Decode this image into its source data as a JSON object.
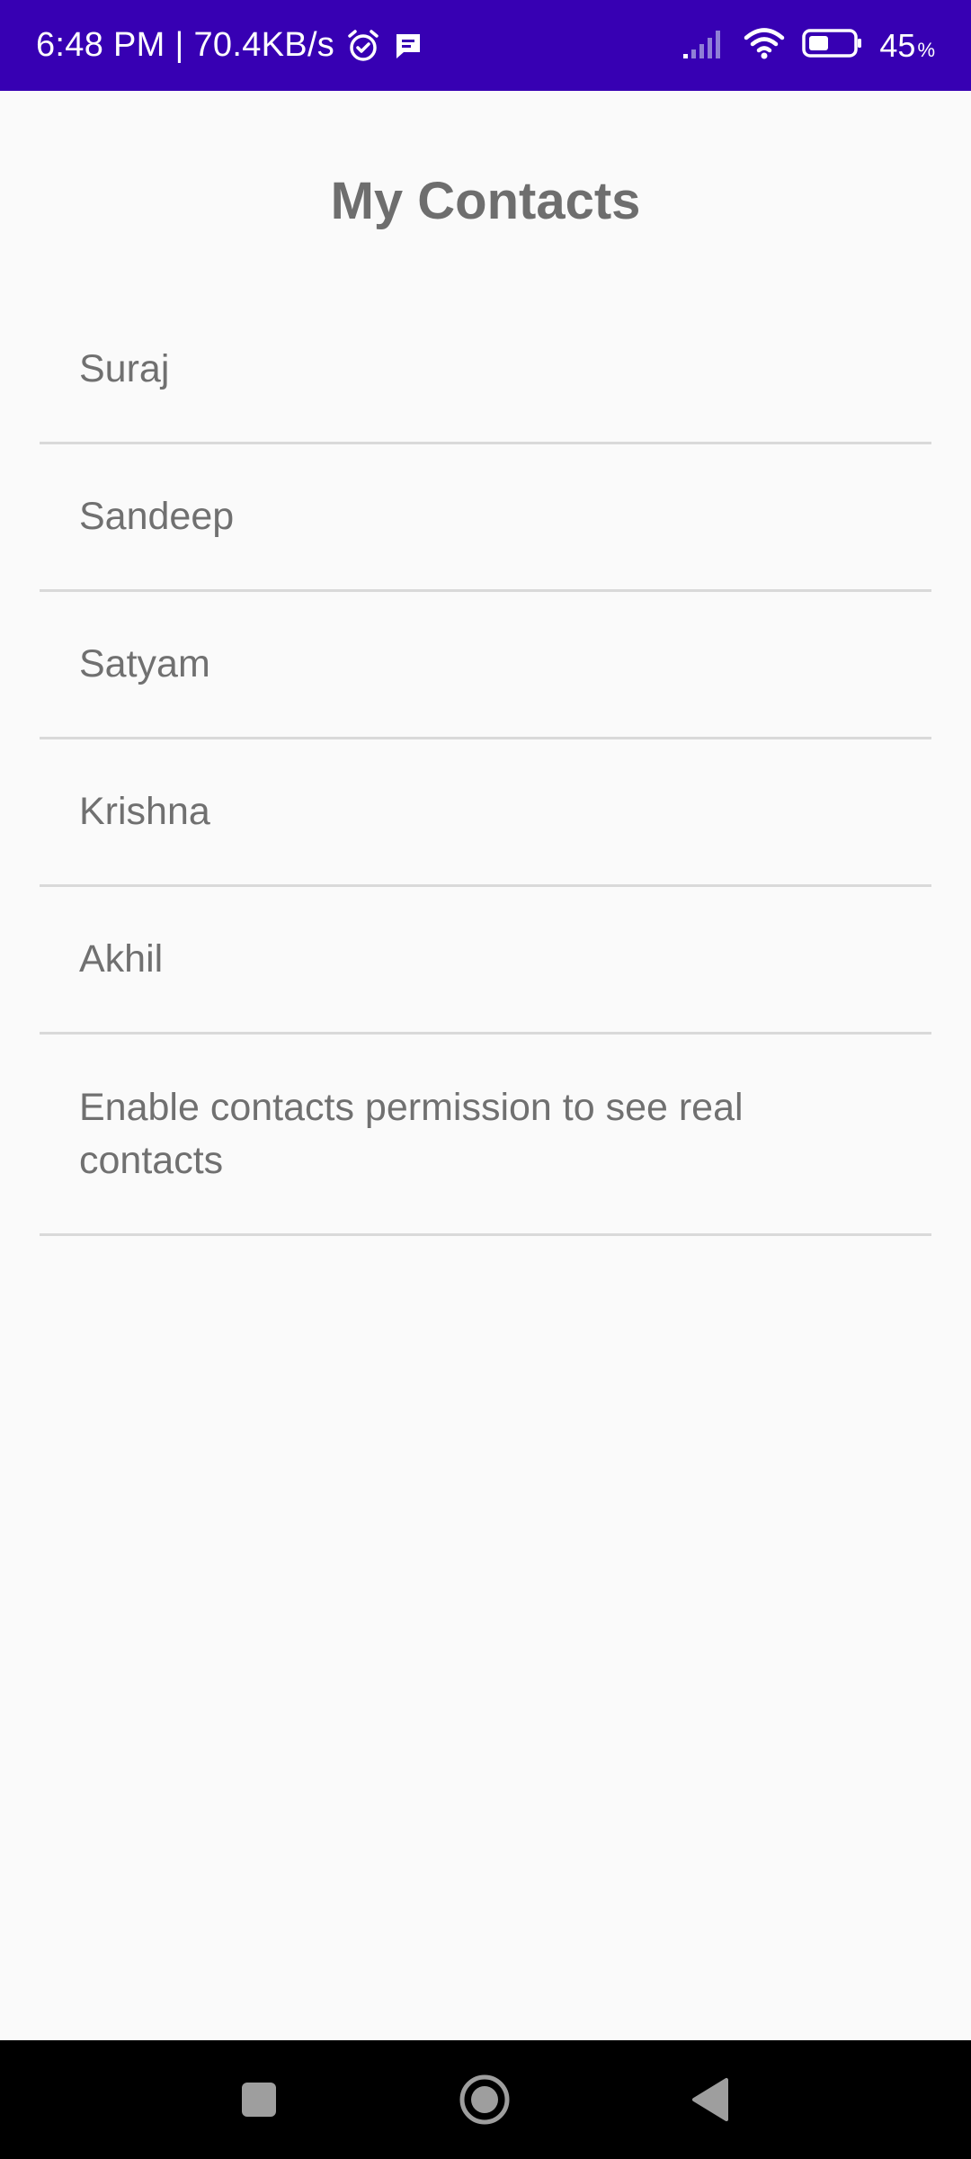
{
  "status_bar": {
    "time_speed": "6:48 PM | 70.4KB/s",
    "battery_value": "45",
    "battery_unit": "%",
    "icons": [
      "alarm-icon",
      "message-icon",
      "signal-icon",
      "wifi-icon",
      "battery-icon"
    ],
    "battery_level": 0.45
  },
  "page": {
    "title": "My Contacts"
  },
  "contacts": [
    {
      "name": "Suraj"
    },
    {
      "name": "Sandeep"
    },
    {
      "name": "Satyam"
    },
    {
      "name": "Krishna"
    },
    {
      "name": "Akhil"
    }
  ],
  "permission_notice": "Enable contacts permission to see real contacts",
  "nav": {
    "icons": [
      "recents-icon",
      "home-icon",
      "back-icon"
    ]
  },
  "colors": {
    "status_bar": "#3700b3",
    "background": "#fafafa",
    "text": "#707070",
    "divider": "#d9d9d9",
    "nav_bar": "#000000"
  }
}
